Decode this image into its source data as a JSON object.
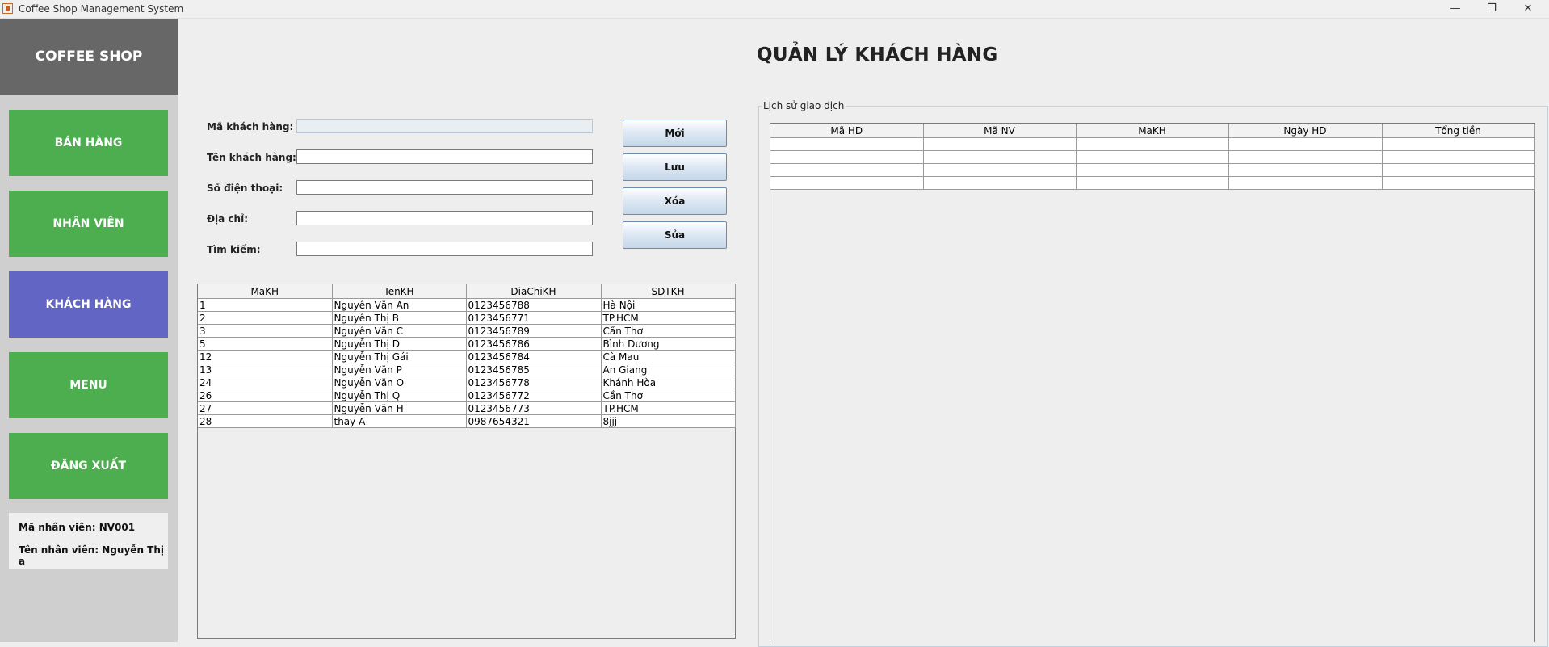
{
  "window": {
    "title": "Coffee Shop Management System",
    "minimize": "—",
    "maximize": "❐",
    "close": "✕"
  },
  "sidebar": {
    "brand": "COFFEE SHOP",
    "items": [
      {
        "label": "BÁN HÀNG",
        "active": false
      },
      {
        "label": "NHÂN VIÊN",
        "active": false
      },
      {
        "label": "KHÁCH HÀNG",
        "active": true
      },
      {
        "label": "MENU",
        "active": false
      },
      {
        "label": "ĐĂNG XUẤT",
        "active": false
      }
    ],
    "employee": {
      "id_text": "Mã nhân viên: NV001",
      "name_text": "Tên nhân viên: Nguyễn Thị a"
    }
  },
  "page": {
    "title": "QUẢN LÝ KHÁCH HÀNG"
  },
  "form": {
    "ma_kh": {
      "label": "Mã khách hàng:",
      "value": ""
    },
    "ten_kh": {
      "label": "Tên khách hàng:",
      "value": ""
    },
    "sdt": {
      "label": "Số điện thoại:",
      "value": ""
    },
    "dia_chi": {
      "label": "Địa chỉ:",
      "value": ""
    },
    "tim_kiem": {
      "label": "Tìm kiếm:",
      "value": ""
    }
  },
  "actions": {
    "new": "Mới",
    "save": "Lưu",
    "delete": "Xóa",
    "edit": "Sửa"
  },
  "customers": {
    "columns": [
      "MaKH",
      "TenKH",
      "DiaChiKH",
      "SDTKH"
    ],
    "rows": [
      [
        "1",
        "Nguyễn Văn An",
        "0123456788",
        "Hà Nội"
      ],
      [
        "2",
        "Nguyễn Thị B",
        "0123456771",
        "TP.HCM"
      ],
      [
        "3",
        "Nguyễn Văn C",
        "0123456789",
        "Cần Thơ"
      ],
      [
        "5",
        "Nguyễn Thị D",
        "0123456786",
        "Bình Dương"
      ],
      [
        "12",
        "Nguyễn Thị Gái",
        "0123456784",
        "Cà Mau"
      ],
      [
        "13",
        "Nguyễn Văn P",
        "0123456785",
        "An Giang"
      ],
      [
        "24",
        "Nguyễn Văn O",
        "0123456778",
        "Khánh Hòa"
      ],
      [
        "26",
        "Nguyễn Thị Q",
        "0123456772",
        "Cần Thơ"
      ],
      [
        "27",
        "Nguyễn Văn H",
        "0123456773",
        "TP.HCM"
      ],
      [
        "28",
        "thay A",
        "0987654321",
        "8jjj"
      ]
    ]
  },
  "history": {
    "title": "Lịch sử giao dịch",
    "columns": [
      "Mã HD",
      "Mã NV",
      "MaKH",
      "Ngày HD",
      "Tổng tiền"
    ],
    "rows": [
      [
        "",
        "",
        "",
        "",
        ""
      ],
      [
        "",
        "",
        "",
        "",
        ""
      ],
      [
        "",
        "",
        "",
        "",
        ""
      ],
      [
        "",
        "",
        "",
        "",
        ""
      ]
    ]
  }
}
